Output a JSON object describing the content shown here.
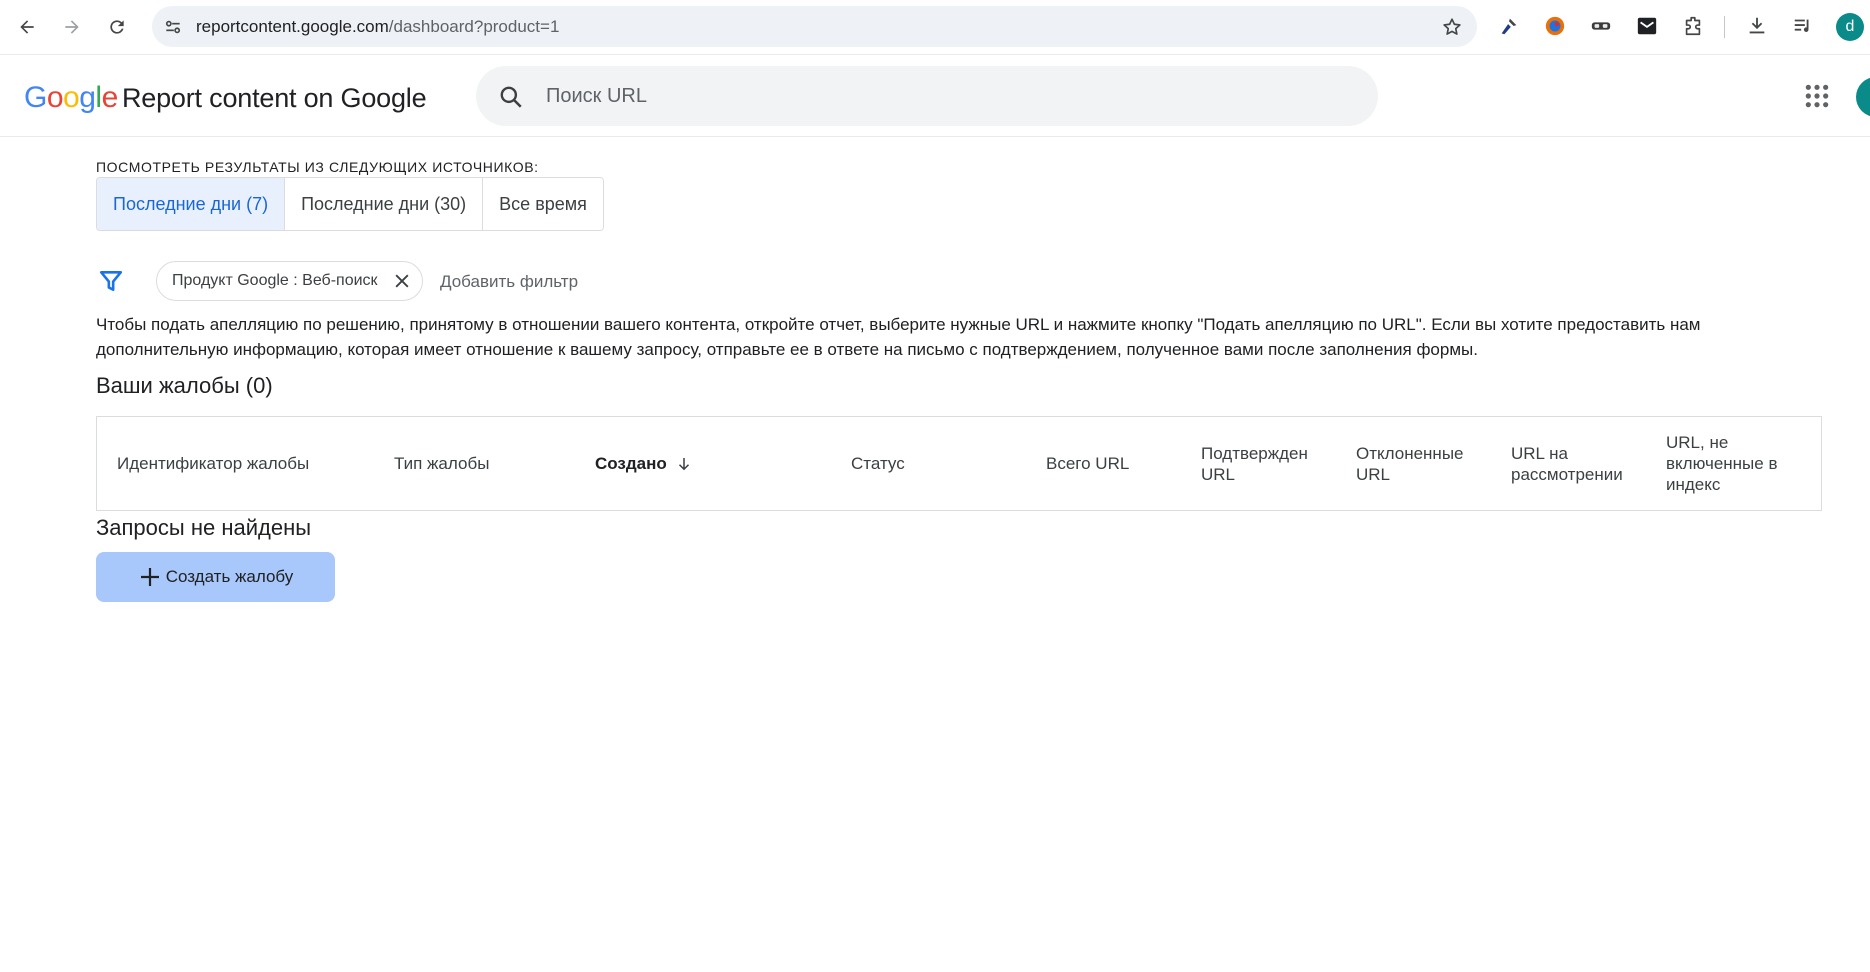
{
  "browser": {
    "url_host": "reportcontent.google.com",
    "url_path": "/dashboard?product=1",
    "profile_initial": "d",
    "extensions": [
      "tool-icon",
      "color-orb-icon",
      "mask-icon",
      "envelope-icon",
      "puzzle-icon",
      "download-icon",
      "media-list-icon"
    ]
  },
  "header": {
    "logo_letters": [
      "G",
      "o",
      "o",
      "g",
      "l",
      "e"
    ],
    "logo_colors": [
      "#4285F4",
      "#EA4335",
      "#FBBC05",
      "#4285F4",
      "#34A853",
      "#EA4335"
    ],
    "title": "Report content on Google",
    "search_placeholder": "Поиск URL"
  },
  "sources": {
    "label": "ПОСМОТРЕТЬ РЕЗУЛЬТАТЫ ИЗ СЛЕДУЮЩИХ ИСТОЧНИКОВ:",
    "options": [
      {
        "label": "Последние дни (7)",
        "active": true
      },
      {
        "label": "Последние дни (30)",
        "active": false
      },
      {
        "label": "Все время",
        "active": false
      }
    ]
  },
  "filters": {
    "chip_label": "Продукт Google : Веб-поиск",
    "add_filter": "Добавить фильтр"
  },
  "info_text": "Чтобы подать апелляцию по решению, принятому в отношении вашего контента, откройте отчет, выберите нужные URL и нажмите кнопку \"Подать апелляцию по URL\". Если вы хотите предоставить нам дополнительную информацию, которая имеет отношение к вашему запросу, отправьте ее в ответе на письмо с подтверждением, полученное вами после заполнения формы.",
  "complaints": {
    "title": "Ваши жалобы (0)",
    "columns": [
      "Идентификатор жалобы",
      "Тип жалобы",
      "Создано",
      "Статус",
      "Всего URL",
      "Подтвержден URL",
      "Отклоненные URL",
      "URL на рассмотрении",
      "URL, не включенные в индекс"
    ],
    "empty_text": "Запросы не найдены",
    "create_button": "Создать жалобу"
  },
  "colors": {
    "accent": "#1967d2",
    "active_tab_bg": "#e8f0fe",
    "create_button_bg": "#a8c7fa",
    "filter_icon": "#1a73e8"
  }
}
